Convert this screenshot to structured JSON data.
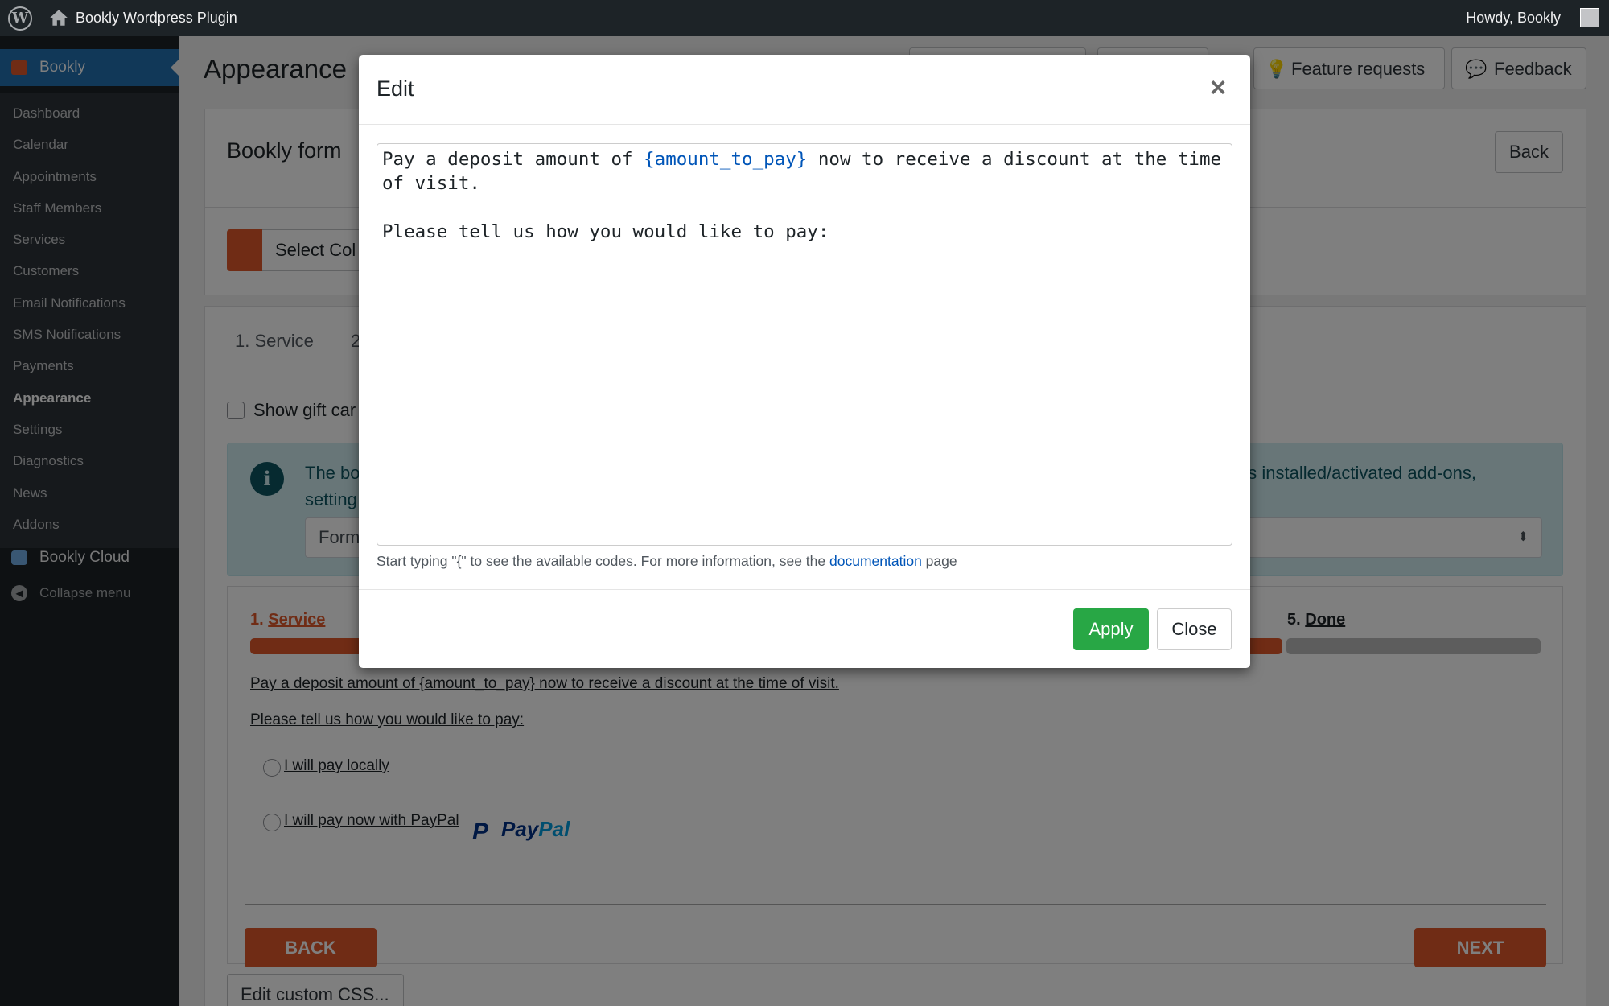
{
  "adminbar": {
    "site_name": "Bookly Wordpress Plugin",
    "howdy": "Howdy, Bookly",
    "wp_logo": "W"
  },
  "sidebar": {
    "plugin_label": "Bookly",
    "items": [
      {
        "label": "Dashboard"
      },
      {
        "label": "Calendar"
      },
      {
        "label": "Appointments"
      },
      {
        "label": "Staff Members"
      },
      {
        "label": "Services"
      },
      {
        "label": "Customers"
      },
      {
        "label": "Email Notifications"
      },
      {
        "label": "SMS Notifications"
      },
      {
        "label": "Payments"
      },
      {
        "label": "Appearance"
      },
      {
        "label": "Settings"
      },
      {
        "label": "Diagnostics"
      },
      {
        "label": "News"
      },
      {
        "label": "Addons"
      }
    ],
    "current": "Appearance",
    "cloud_label": "Bookly Cloud",
    "collapse_label": "Collapse menu"
  },
  "page": {
    "title": "Appearance",
    "feature_requests": "Feature requests",
    "feedback": "Feedback",
    "form_title": "Bookly form",
    "back_label": "Back",
    "select_color": "Select Col",
    "tab_service": "1. Service",
    "tab_2": "2",
    "show_gift_label": "Show gift car",
    "info_text_left": "The bo",
    "info_text_right": "as installed/activated add-ons,",
    "info_text_line2": "setting",
    "info_select_text": "Form",
    "edit_css": "Edit custom CSS..."
  },
  "preview": {
    "step1_num": "1.",
    "step1_label": "Service",
    "step5_num": "5.",
    "step5_label": "Done",
    "line1": "Pay a deposit amount of {amount_to_pay} now to receive a discount at the time of visit.",
    "line2": "Please tell us how you would like to pay:",
    "option_local": "I will pay locally",
    "option_paypal": "I will pay now with PayPal",
    "paypal_pay": "Pay",
    "paypal_pal": "Pal",
    "back_btn": "BACK",
    "next_btn": "NEXT",
    "accent_color": "#e0592a"
  },
  "modal": {
    "title": "Edit",
    "close_icon": "×",
    "editor_pre": "Pay a deposit amount of ",
    "editor_code": "{amount_to_pay}",
    "editor_post": " now to receive a discount at the time\nof visit.\n\nPlease tell us how you would like to pay:",
    "hint_pre": "Start typing \"{\" to see the available codes. For more information, see the ",
    "hint_link": "documentation",
    "hint_post": " page",
    "apply": "Apply",
    "close": "Close",
    "apply_color": "#28a745"
  }
}
